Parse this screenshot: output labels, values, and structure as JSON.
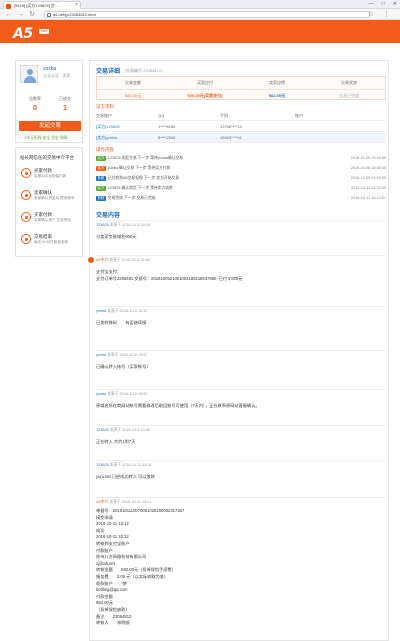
{
  "browser": {
    "tab_title": "[9429] [买方123625] 交...",
    "url": "a5.net/jy/22064812.html",
    "controls": [
      "—",
      "□",
      "✕"
    ]
  },
  "site": {
    "logo": "A5",
    "logo_badge": "net"
  },
  "profile": {
    "username": "yuxba",
    "meta": "企业认证 · 卖家",
    "stat1_label": "总数率",
    "stat1_value": "0",
    "stat2_label": "已成交",
    "stat2_value": "1",
    "publish_label": "发起交易",
    "safe_tip": "✓ 5年无担保 安全 资金 保障"
  },
  "process": {
    "title": "站长网信任的交易中介平台",
    "steps": [
      {
        "title": "买家付款",
        "desc": "买家向平台担保付款"
      },
      {
        "title": "卖家确认",
        "desc": "卖家确认资金后 提供帐号"
      },
      {
        "title": "买家付款",
        "desc": "买家确认资产 交易完成"
      },
      {
        "title": "交易结束",
        "desc": "每天10:00打款到卖家"
      }
    ]
  },
  "detail": {
    "title": "交易详细",
    "title_meta": "（交易编号 22064812）",
    "headers": [
      "交易金额",
      "买家应付",
      "卖家应得",
      "交易状态"
    ],
    "values": [
      "600.00元",
      "600.00元(买家支付)",
      "582.00元",
      "交易已完成"
    ]
  },
  "accounts": {
    "title": "双方资料",
    "headers": [
      "交易账户",
      "QQ",
      "手机",
      "账户"
    ],
    "rows": [
      [
        "[买方]123625",
        "1****6186",
        "13766****13",
        ""
      ],
      [
        "[卖方]yuxba",
        "8****2266",
        "18463****91",
        ""
      ]
    ]
  },
  "logs": {
    "title": "操作内容",
    "rows": [
      {
        "tag": "买方",
        "color": "#5aa83c",
        "text": "123625 发起交易 下一步 等待yuxba确认交易",
        "time": "2016-10-05 15:34:56"
      },
      {
        "tag": "卖方",
        "color": "#f25b1a",
        "text": "yuxba 确认交易 下一步 等待买方付款",
        "time": "2016-10-06 15:36:49"
      },
      {
        "tag": "系统",
        "color": "#1e73be",
        "text": "已付款到A5交易担保 下一步 卖方开始交易",
        "time": "2016-10-05 15:46:33"
      },
      {
        "tag": "买方",
        "color": "#5aa83c",
        "text": "123625 确认收货 下一步 等待卖方收款",
        "time": "2016-10-11 14:32:49"
      },
      {
        "tag": "系统",
        "color": "#1e73be",
        "text": "交易完成 下一步 交易已完成",
        "time": "2016-10-11 15:12:31"
      }
    ]
  },
  "content": {
    "title": "交易内容",
    "messages": [
      {
        "user": "123625",
        "role": "发表于 2016-10-5 15:34",
        "body": "与卖家交易域名600元"
      },
      {
        "user": "A5中介",
        "role": "发表于 2016-10-5 15:46",
        "body": "支付宝支付：\n支付订单号2206481 交易号：2016100521001004180218637980, 已付￥600元"
      },
      {
        "user": "yuxba",
        "role": "发表于 2016-10-5 19:30",
        "body": "已发转移码　　有否继续接"
      },
      {
        "user": "yuxba",
        "role": "发表于 2016-10-6 19:52",
        "body": "已确认转入帐号（买家帐号）"
      },
      {
        "user": "yuxba",
        "role": "发表于 2016-10-5 19:52",
        "body": "原域名所在商网站帐号需要修改后取回账号可使用（7天内），正在联系原网站客服确认。"
      },
      {
        "user": "123625",
        "role": "发表于 2016-10-6 10:36",
        "body": "正在转入 大约1到7天"
      },
      {
        "user": "123625",
        "role": "发表于 2016-10-11 14:31",
        "body": "yuni.net 已经成功转入 可以放款"
      },
      {
        "user": "A5中介",
        "role": "发表于 2016-10-11 15:12",
        "body": "单据号　2016101110070001020200002317357\n接交申请\n2016-10-11 15:12\n成功\n2016-10-11 15:12\n转帐到支付宝帐户\n付款账户\n徐州八方网络科技有限公司\nzj@a5.net\n转帐金额　　582.00元（扣掉保险手续费）\n服务费　　2.00 元（以实际收取为准）\n收款账户　　*梦\nbettling@qq.com\n付款金额\n584.00元\n（扣掉保险缺款）\n备注　　22064812\n转帐人　　林明顺"
      }
    ]
  }
}
